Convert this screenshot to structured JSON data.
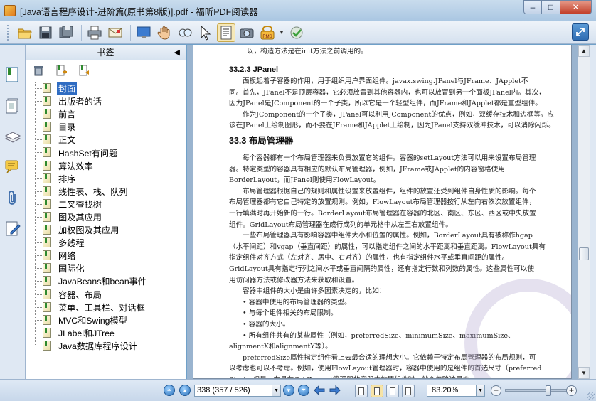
{
  "window": {
    "title": "[Java语言程序设计-进阶篇(原书第8版)].pdf - 福昕PDF阅读器"
  },
  "toolbar": {
    "icons": [
      "open-folder-icon",
      "save-icon",
      "save-as-icon",
      "print-icon",
      "email-icon",
      "fullscreen-icon",
      "hand-icon",
      "zoom-glass-icon",
      "select-arrow-icon",
      "text-select-icon",
      "snapshot-icon",
      "rms-icon",
      "sign-icon"
    ],
    "rms_label": "RMS"
  },
  "bookmarks": {
    "title": "书签",
    "selected_index": 0,
    "items": [
      "封面",
      "出版者的话",
      "前言",
      "目录",
      "正文",
      "HashSet有问题",
      "算法效率",
      "排序",
      "线性表、栈、队列",
      "二叉查找树",
      "图及其应用",
      "加权图及其应用",
      "多线程",
      "网络",
      "国际化",
      "JavaBeans和bean事件",
      "容器、布局",
      "菜单、工具栏、对话框",
      "MVC和Swing模型",
      "JLabel和JTree",
      "Java数据库程序设计"
    ]
  },
  "document": {
    "line0": "以，构造方法是在init方法之前调用的。",
    "h_3_2_3": "33.2.3  JPanel",
    "p1": [
      "面板起着子容器的作用，用于组织用户界面组件。javax.swing.JPanel与JFrame、JApplet不",
      "同。首先，JPanel不是顶层容器，它必须放置到其他容器内，也可以放置到另一个面板JPanel内。其次，",
      "因为JPanel是JComponent的一个子类，所以它是一个轻型组件，而JFrame和JApplet都是重型组件。",
      "作为JComponent的一个子类，JPanel可以利用JComponent的优点，例如，双缓存技术和边框等。应",
      "该在JPanel上绘制图形，而不要在JFrame和JApplet上绘制，因为JPanel支持双缓冲技术，可以消除闪烁。"
    ],
    "h_3_3": "33.3  布局管理器",
    "p2": [
      "每个容器都有一个布局管理器来负责放置它的组件。容器的setLayout方法可以用来设置布局管理",
      "器。特定类型的容器具有相应的默认布局管理器，例如，JFrame或JApplet的内容窗格使用",
      "BorderLayout，而JPanel则使用FlowLayout。",
      "布局管理器根据自己的规则和属性设置来放置组件，组件的放置还受到组件自身性质的影响。每个",
      "布局管理器都有它自己特定的放置规则。例如，FlowLayout布局管理器按行从左向右依次放置组件，",
      "一行填满时再开始新的一行。BorderLayout布局管理器在容器的北区、南区、东区、西区或中央放置",
      "组件。GridLayout布局管理器在成行成列的单元格中从左至右放置组件。",
      "一些布局管理器具有影响容器中组件大小和位置的属性。例如，BorderLayout具有被称作hgap",
      "（水平间距）和vgap（垂直间距）的属性，可以指定组件之间的水平距离和垂直距离。FlowLayout具有",
      "指定组件对齐方式（左对齐、居中、右对齐）的属性，也有指定组件水平或垂直间距的属性。",
      "GridLayout具有指定行列之间水平或垂直间隔的属性，还有指定行数和列数的属性。这些属性可以使",
      "用访问器方法或修改器方法来获取和设置。",
      "容器中组件的大小是由许多因素决定的，比如：",
      "• 容器中使用的布局管理器的类型。",
      "• 与每个组件相关的布局限制。",
      "• 容器的大小。",
      "• 所有组件共有的某些属性（例如，preferredSize、minimumSize、maximumSize、",
      "alignmentX和alignmentY等）。",
      "preferredSize属性指定组件看上去最合适的理想大小。它依赖于特定布局管理器的布局规则，可",
      "以考虑也可以不考虑。例如，使用FlowLayout管理器时，容器中使用的是组件的首选尺寸（preferred",
      "Size)，但是，在具有GridLayout管理器的容器中放置组件时，就会忽略该属性。"
    ]
  },
  "status": {
    "page_input": "338 (357 / 526)",
    "zoom": "83.20%",
    "zoom_minus": "−",
    "zoom_plus": "+",
    "zoom_slider_fraction": 0.7
  },
  "scroll": {
    "position_fraction": 0.64
  },
  "colors": {
    "selection": "#2f6cc2",
    "doc_background": "#9ab4cf"
  }
}
